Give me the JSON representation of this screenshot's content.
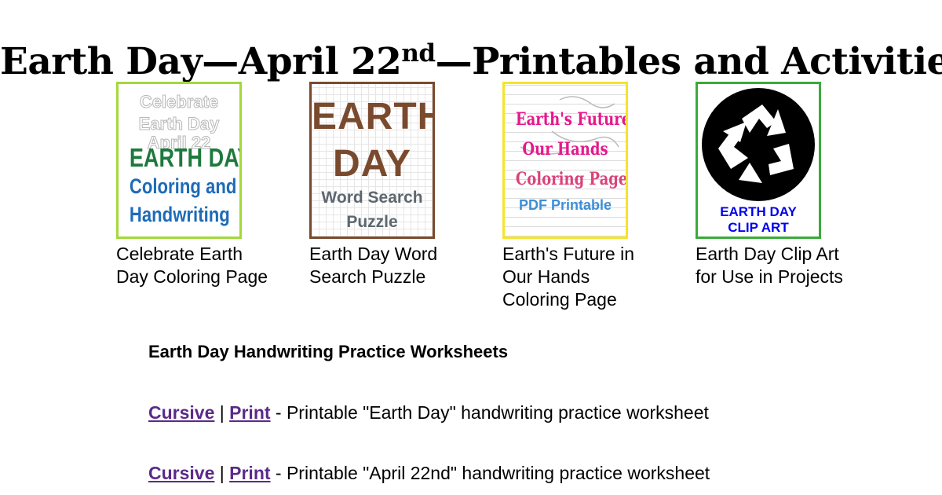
{
  "page": {
    "title_main": "Earth Day—April 22",
    "title_sup": "nd",
    "title_end": "—Printables and Activities"
  },
  "cards": [
    {
      "caption": "Celebrate Earth Day Coloring Page",
      "border_color": "#a3d93a",
      "thumb_lines": [
        "Celebrate",
        "Earth Day",
        "April 22",
        "EARTH DAY",
        "Coloring and",
        "Handwriting"
      ]
    },
    {
      "caption": "Earth Day Word Search Puzzle",
      "border_color": "#7a4a2e",
      "thumb_lines": [
        "EARTH",
        "DAY",
        "Word Search",
        "Puzzle"
      ]
    },
    {
      "caption": "Earth's Future in Our Hands Coloring Page",
      "border_color": "#f4e52a",
      "thumb_lines": [
        "Earth's Future in",
        "Our Hands",
        "Coloring Page",
        "PDF Printable"
      ]
    },
    {
      "caption": "Earth Day Clip Art for Use in Projects",
      "border_color": "#3aaa3a",
      "thumb_lines": [
        "EARTH DAY",
        "CLIP ART"
      ],
      "icon": "recycle-icon"
    }
  ],
  "worksheets": {
    "heading": "Earth Day Handwriting Practice Worksheets",
    "rows": [
      {
        "cursive": "Cursive",
        "sep": "|",
        "print": "Print",
        "desc": " - Printable \"Earth Day\" handwriting practice worksheet"
      },
      {
        "cursive": "Cursive",
        "sep": "|",
        "print": "Print",
        "desc": " - Printable \"April 22nd\" handwriting practice worksheet"
      }
    ]
  },
  "colors": {
    "link": "#5a2a8a",
    "green_text": "#1c7a3c",
    "blue_text": "#1e6bb8",
    "brown_text": "#7a4a2e",
    "gray_text": "#5d6770",
    "magenta_text": "#e5198c",
    "pink_text": "#d9447a",
    "sky_text": "#3d8fd8"
  }
}
